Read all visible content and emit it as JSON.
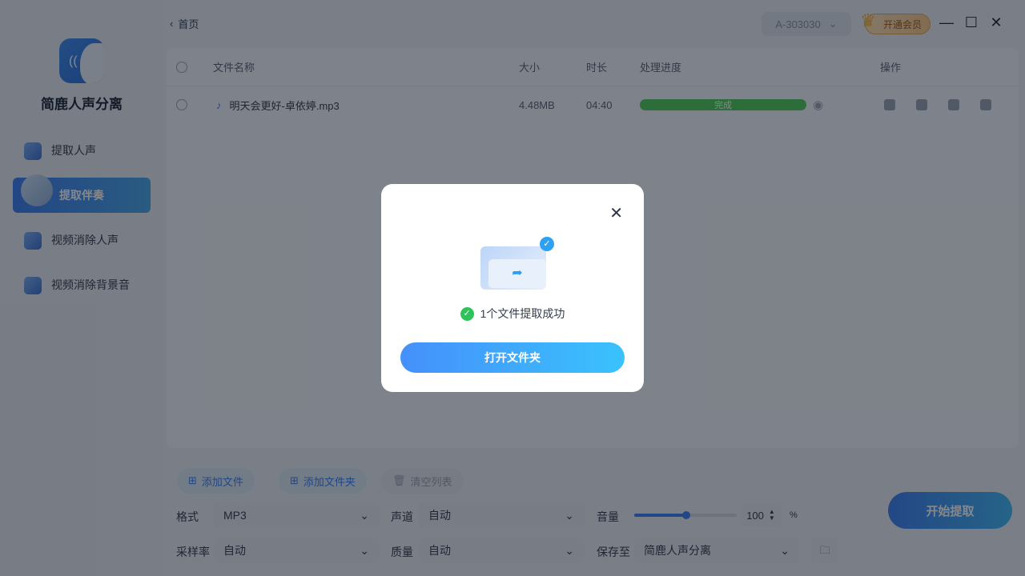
{
  "app": {
    "name": "简鹿人声分离"
  },
  "sidebar": {
    "items": [
      {
        "label": "提取人声"
      },
      {
        "label": "提取伴奏"
      },
      {
        "label": "视频消除人声"
      },
      {
        "label": "视频消除背景音"
      }
    ]
  },
  "header": {
    "back_label": "首页",
    "account": "A-303030",
    "vip_label": "开通会员"
  },
  "table": {
    "headers": {
      "name": "文件名称",
      "size": "大小",
      "duration": "时长",
      "progress": "处理进度",
      "actions": "操作"
    },
    "rows": [
      {
        "name": "明天会更好-卓依婷.mp3",
        "size": "4.48MB",
        "duration": "04:40",
        "status": "完成",
        "progress": 100
      }
    ]
  },
  "toolbar": {
    "add_file": "添加文件",
    "add_folder": "添加文件夹",
    "clear": "清空列表"
  },
  "settings": {
    "format_label": "格式",
    "format": "MP3",
    "channel_label": "声道",
    "channel": "自动",
    "volume_label": "音量",
    "volume": "100",
    "volume_unit": "%",
    "volume_fraction": 0.5,
    "samplerate_label": "采样率",
    "samplerate": "自动",
    "quality_label": "质量",
    "quality": "自动",
    "saveto_label": "保存至",
    "saveto": "简鹿人声分离"
  },
  "start_label": "开始提取",
  "modal": {
    "message": "1个文件提取成功",
    "button": "打开文件夹"
  }
}
